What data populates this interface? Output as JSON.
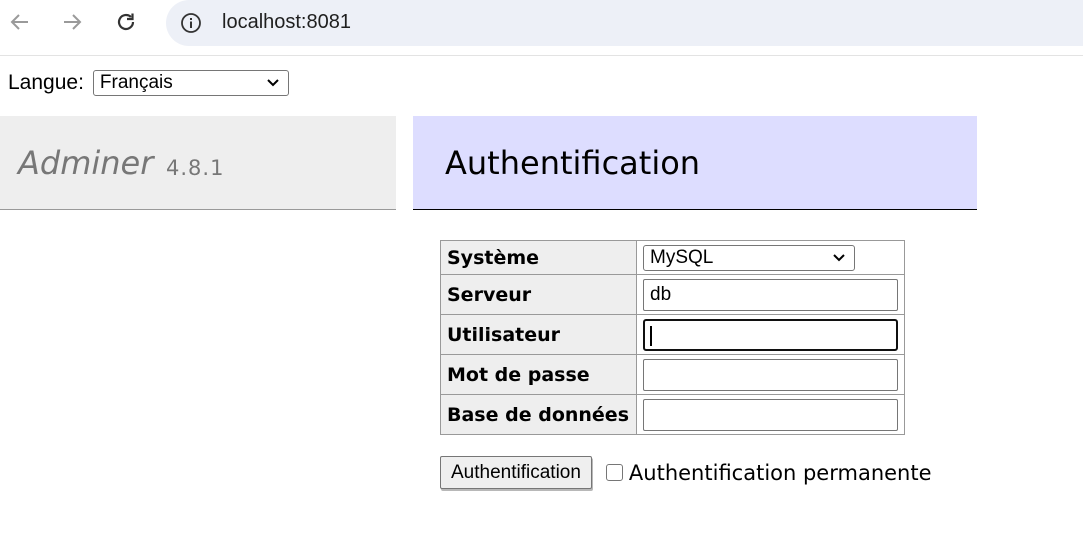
{
  "browser": {
    "url": "localhost:8081",
    "icons": {
      "back": "arrow-left-icon",
      "forward": "arrow-right-icon",
      "reload": "reload-icon",
      "site_info": "info-icon"
    }
  },
  "language": {
    "label": "Langue:",
    "selected": "Français"
  },
  "menu": {
    "logo": "Adminer",
    "version": "4.8.1"
  },
  "content": {
    "title": "Authentification"
  },
  "form": {
    "fields": [
      {
        "label": "Système",
        "value": "MySQL",
        "type": "select"
      },
      {
        "label": "Serveur",
        "value": "db",
        "type": "text"
      },
      {
        "label": "Utilisateur",
        "value": "",
        "type": "text",
        "focused": true
      },
      {
        "label": "Mot de passe",
        "value": "",
        "type": "password"
      },
      {
        "label": "Base de données",
        "value": "",
        "type": "text"
      }
    ],
    "submit_label": "Authentification",
    "permanent_label": "Authentification permanente",
    "permanent_checked": false
  },
  "colors": {
    "content_header_bg": "#ddddff",
    "menu_header_bg": "#eeeeee",
    "omnibox_bg": "#edf0f7"
  }
}
